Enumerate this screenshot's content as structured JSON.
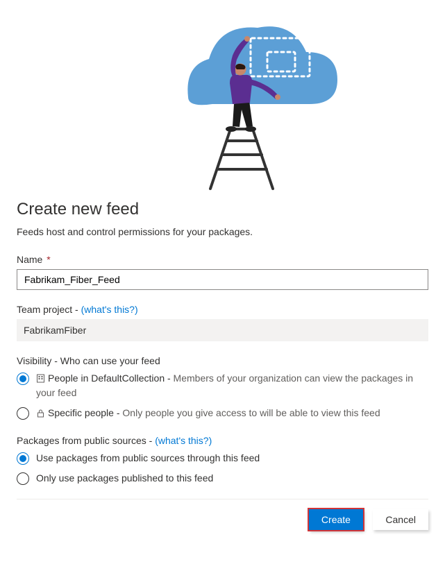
{
  "title": "Create new feed",
  "subtitle": "Feeds host and control permissions for your packages.",
  "name": {
    "label": "Name",
    "required": "*",
    "value": "Fabrikam_Fiber_Feed"
  },
  "team_project": {
    "label": "Team project -",
    "link": "(what's this?)",
    "value": "FabrikamFiber"
  },
  "visibility": {
    "label": "Visibility - Who can use your feed",
    "options": [
      {
        "title": "People in DefaultCollection -",
        "desc": "Members of your organization can view the packages in your feed",
        "checked": true
      },
      {
        "title": "Specific people -",
        "desc": "Only people you give access to will be able to view this feed",
        "checked": false
      }
    ]
  },
  "packages": {
    "label": "Packages from public sources -",
    "link": "(what's this?)",
    "options": [
      {
        "text": "Use packages from public sources through this feed",
        "checked": true
      },
      {
        "text": "Only use packages published to this feed",
        "checked": false
      }
    ]
  },
  "buttons": {
    "create": "Create",
    "cancel": "Cancel"
  }
}
